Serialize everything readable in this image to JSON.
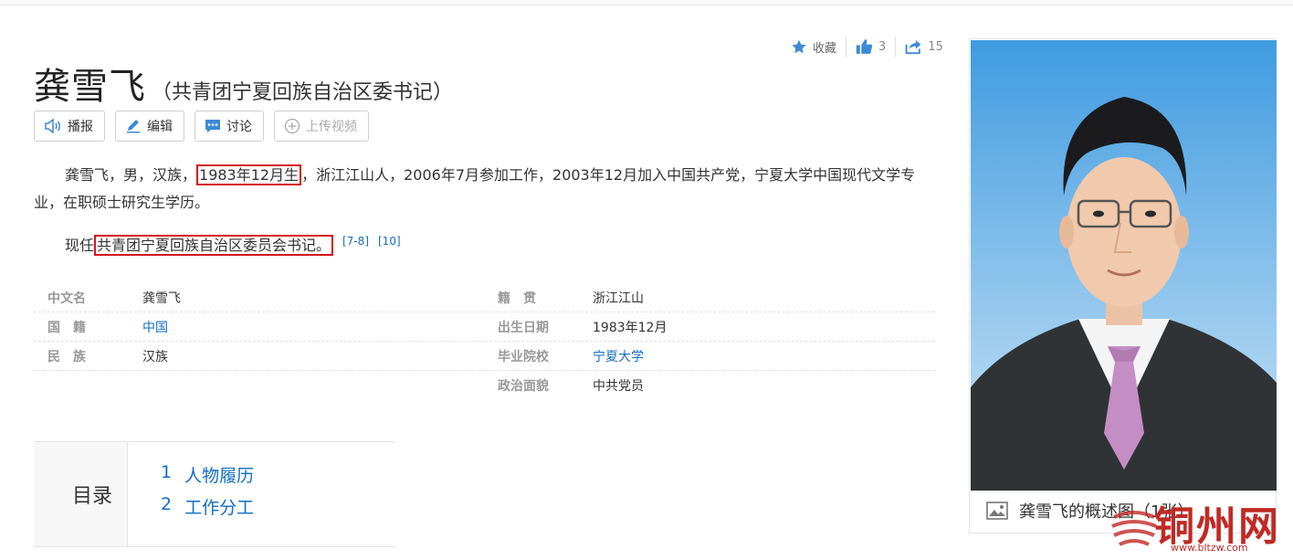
{
  "actions": {
    "favorite_label": "收藏",
    "like_count": "3",
    "share_count": "15"
  },
  "title": {
    "name": "龚雪飞",
    "subtitle": "（共青团宁夏回族自治区委书记）"
  },
  "toolbar": {
    "broadcast": "播报",
    "edit": "编辑",
    "discuss": "讨论",
    "upload_video": "上传视频"
  },
  "summary": {
    "p1_a": "龚雪飞，男，汉族，",
    "p1_hl": "1983年12月生",
    "p1_b": "，浙江江山人，2006年7月参加工作，2003年12月加入中国共产党，宁夏大学中国现代文学专业，在职硕士研究生学历。",
    "p2_a": "现任",
    "p2_hl": "共青团宁夏回族自治区委员会书记。",
    "ref1": "[7-8]",
    "ref2": "[10]"
  },
  "info": {
    "left": [
      {
        "label": "中文名",
        "value": "龚雪飞"
      },
      {
        "label": "国　籍",
        "value": "中国"
      },
      {
        "label": "民　族",
        "value": "汉族"
      }
    ],
    "right": [
      {
        "label": "籍　贯",
        "value": "浙江江山"
      },
      {
        "label": "出生日期",
        "value": "1983年12月"
      },
      {
        "label": "毕业院校",
        "value": "宁夏大学"
      },
      {
        "label": "政治面貌",
        "value": "中共党员"
      }
    ]
  },
  "catalog": {
    "title": "目录",
    "items": [
      {
        "num": "1",
        "label": "人物履历"
      },
      {
        "num": "2",
        "label": "工作分工"
      }
    ]
  },
  "picture": {
    "caption": "龚雪飞的概述图（1张）"
  },
  "watermark": {
    "text": "铜州网",
    "url": "www.bltzw.com"
  },
  "colors": {
    "link": "#136ec2",
    "highlight_box": "#d5141c",
    "photo_bg_top": "#3f9be0",
    "photo_bg_bottom": "#cfe6f7",
    "watermark": "#c02a25"
  }
}
